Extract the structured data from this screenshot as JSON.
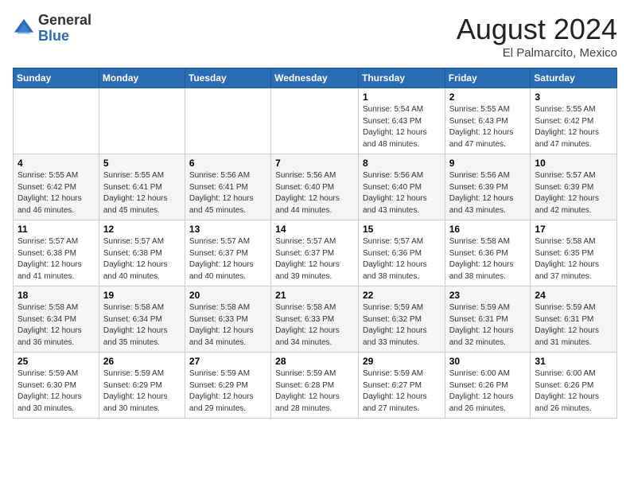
{
  "header": {
    "logo_general": "General",
    "logo_blue": "Blue",
    "month_year": "August 2024",
    "location": "El Palmarcito, Mexico"
  },
  "days_of_week": [
    "Sunday",
    "Monday",
    "Tuesday",
    "Wednesday",
    "Thursday",
    "Friday",
    "Saturday"
  ],
  "weeks": [
    [
      {
        "day": "",
        "info": ""
      },
      {
        "day": "",
        "info": ""
      },
      {
        "day": "",
        "info": ""
      },
      {
        "day": "",
        "info": ""
      },
      {
        "day": "1",
        "info": "Sunrise: 5:54 AM\nSunset: 6:43 PM\nDaylight: 12 hours\nand 48 minutes."
      },
      {
        "day": "2",
        "info": "Sunrise: 5:55 AM\nSunset: 6:43 PM\nDaylight: 12 hours\nand 47 minutes."
      },
      {
        "day": "3",
        "info": "Sunrise: 5:55 AM\nSunset: 6:42 PM\nDaylight: 12 hours\nand 47 minutes."
      }
    ],
    [
      {
        "day": "4",
        "info": "Sunrise: 5:55 AM\nSunset: 6:42 PM\nDaylight: 12 hours\nand 46 minutes."
      },
      {
        "day": "5",
        "info": "Sunrise: 5:55 AM\nSunset: 6:41 PM\nDaylight: 12 hours\nand 45 minutes."
      },
      {
        "day": "6",
        "info": "Sunrise: 5:56 AM\nSunset: 6:41 PM\nDaylight: 12 hours\nand 45 minutes."
      },
      {
        "day": "7",
        "info": "Sunrise: 5:56 AM\nSunset: 6:40 PM\nDaylight: 12 hours\nand 44 minutes."
      },
      {
        "day": "8",
        "info": "Sunrise: 5:56 AM\nSunset: 6:40 PM\nDaylight: 12 hours\nand 43 minutes."
      },
      {
        "day": "9",
        "info": "Sunrise: 5:56 AM\nSunset: 6:39 PM\nDaylight: 12 hours\nand 43 minutes."
      },
      {
        "day": "10",
        "info": "Sunrise: 5:57 AM\nSunset: 6:39 PM\nDaylight: 12 hours\nand 42 minutes."
      }
    ],
    [
      {
        "day": "11",
        "info": "Sunrise: 5:57 AM\nSunset: 6:38 PM\nDaylight: 12 hours\nand 41 minutes."
      },
      {
        "day": "12",
        "info": "Sunrise: 5:57 AM\nSunset: 6:38 PM\nDaylight: 12 hours\nand 40 minutes."
      },
      {
        "day": "13",
        "info": "Sunrise: 5:57 AM\nSunset: 6:37 PM\nDaylight: 12 hours\nand 40 minutes."
      },
      {
        "day": "14",
        "info": "Sunrise: 5:57 AM\nSunset: 6:37 PM\nDaylight: 12 hours\nand 39 minutes."
      },
      {
        "day": "15",
        "info": "Sunrise: 5:57 AM\nSunset: 6:36 PM\nDaylight: 12 hours\nand 38 minutes."
      },
      {
        "day": "16",
        "info": "Sunrise: 5:58 AM\nSunset: 6:36 PM\nDaylight: 12 hours\nand 38 minutes."
      },
      {
        "day": "17",
        "info": "Sunrise: 5:58 AM\nSunset: 6:35 PM\nDaylight: 12 hours\nand 37 minutes."
      }
    ],
    [
      {
        "day": "18",
        "info": "Sunrise: 5:58 AM\nSunset: 6:34 PM\nDaylight: 12 hours\nand 36 minutes."
      },
      {
        "day": "19",
        "info": "Sunrise: 5:58 AM\nSunset: 6:34 PM\nDaylight: 12 hours\nand 35 minutes."
      },
      {
        "day": "20",
        "info": "Sunrise: 5:58 AM\nSunset: 6:33 PM\nDaylight: 12 hours\nand 34 minutes."
      },
      {
        "day": "21",
        "info": "Sunrise: 5:58 AM\nSunset: 6:33 PM\nDaylight: 12 hours\nand 34 minutes."
      },
      {
        "day": "22",
        "info": "Sunrise: 5:59 AM\nSunset: 6:32 PM\nDaylight: 12 hours\nand 33 minutes."
      },
      {
        "day": "23",
        "info": "Sunrise: 5:59 AM\nSunset: 6:31 PM\nDaylight: 12 hours\nand 32 minutes."
      },
      {
        "day": "24",
        "info": "Sunrise: 5:59 AM\nSunset: 6:31 PM\nDaylight: 12 hours\nand 31 minutes."
      }
    ],
    [
      {
        "day": "25",
        "info": "Sunrise: 5:59 AM\nSunset: 6:30 PM\nDaylight: 12 hours\nand 30 minutes."
      },
      {
        "day": "26",
        "info": "Sunrise: 5:59 AM\nSunset: 6:29 PM\nDaylight: 12 hours\nand 30 minutes."
      },
      {
        "day": "27",
        "info": "Sunrise: 5:59 AM\nSunset: 6:29 PM\nDaylight: 12 hours\nand 29 minutes."
      },
      {
        "day": "28",
        "info": "Sunrise: 5:59 AM\nSunset: 6:28 PM\nDaylight: 12 hours\nand 28 minutes."
      },
      {
        "day": "29",
        "info": "Sunrise: 5:59 AM\nSunset: 6:27 PM\nDaylight: 12 hours\nand 27 minutes."
      },
      {
        "day": "30",
        "info": "Sunrise: 6:00 AM\nSunset: 6:26 PM\nDaylight: 12 hours\nand 26 minutes."
      },
      {
        "day": "31",
        "info": "Sunrise: 6:00 AM\nSunset: 6:26 PM\nDaylight: 12 hours\nand 26 minutes."
      }
    ]
  ]
}
